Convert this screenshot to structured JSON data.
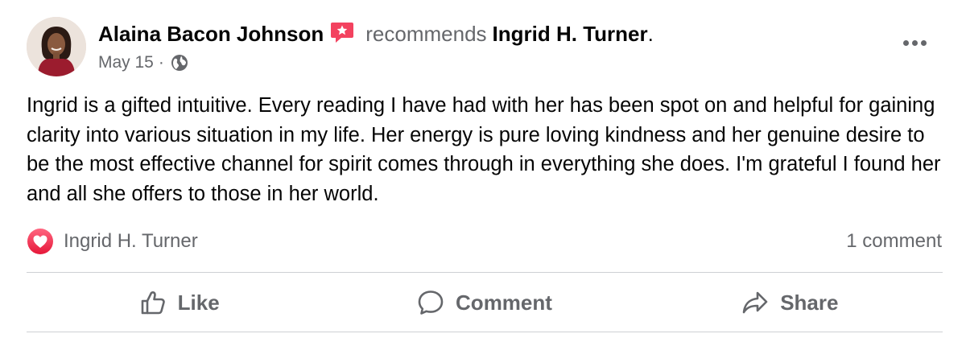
{
  "post": {
    "author": "Alaina Bacon Johnson",
    "action_text": "recommends",
    "page_name": "Ingrid H. Turner",
    "period": ".",
    "date": "May 15",
    "separator": "·",
    "audience_icon": "globe-icon",
    "body": "Ingrid is a gifted intuitive. Every reading I have had with her has been spot on and helpful for gaining clarity into various situation in my life. Her energy is pure loving kindness and her genuine desire to be the most effective channel for spirit comes through in everything she does. I'm grateful I found her and all she offers to those in her world."
  },
  "reactions": {
    "icon": "love-reaction-icon",
    "names": "Ingrid H. Turner",
    "comment_count": "1 comment"
  },
  "actions": {
    "like_label": "Like",
    "comment_label": "Comment",
    "share_label": "Share"
  },
  "colors": {
    "secondary_text": "#65676b",
    "primary_text": "#050505",
    "recommend_badge": "#f3425f",
    "divider": "#ced0d4"
  }
}
